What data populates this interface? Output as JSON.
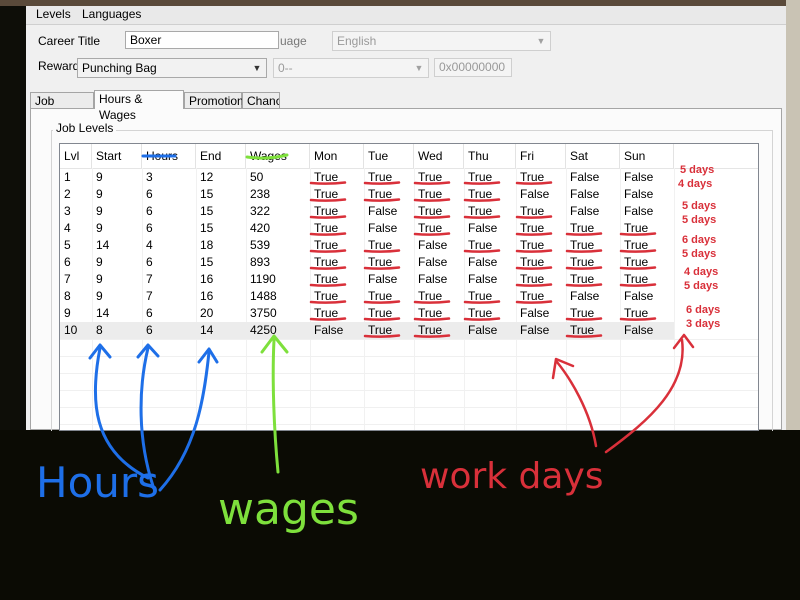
{
  "menu": {
    "items": [
      "Levels",
      "Languages"
    ]
  },
  "form": {
    "career_title_label": "Career Title",
    "career_title_value": "Boxer",
    "language_label": "uage",
    "language_value": "English",
    "reward_label": "Reward",
    "reward_value": "Punching Bag",
    "reward2_value": "0--",
    "hex_value": "0x00000000"
  },
  "tabs": [
    "Job Details",
    "Hours & Wages",
    "Promotion",
    "Chanc"
  ],
  "active_tab": "Hours & Wages",
  "group_title": "Job Levels",
  "columns": [
    "Lvl",
    "Start",
    "Hours",
    "End",
    "Wages",
    "Mon",
    "Tue",
    "Wed",
    "Thu",
    "Fri",
    "Sat",
    "Sun"
  ],
  "rows": [
    [
      "1",
      "9",
      "3",
      "12",
      "50",
      "True",
      "True",
      "True",
      "True",
      "True",
      "False",
      "False"
    ],
    [
      "2",
      "9",
      "6",
      "15",
      "238",
      "True",
      "True",
      "True",
      "True",
      "False",
      "False",
      "False"
    ],
    [
      "3",
      "9",
      "6",
      "15",
      "322",
      "True",
      "False",
      "True",
      "True",
      "True",
      "False",
      "False"
    ],
    [
      "4",
      "9",
      "6",
      "15",
      "420",
      "True",
      "False",
      "True",
      "False",
      "True",
      "True",
      "True"
    ],
    [
      "5",
      "14",
      "4",
      "18",
      "539",
      "True",
      "True",
      "False",
      "True",
      "True",
      "True",
      "True"
    ],
    [
      "6",
      "9",
      "6",
      "15",
      "893",
      "True",
      "True",
      "False",
      "False",
      "True",
      "True",
      "True"
    ],
    [
      "7",
      "9",
      "7",
      "16",
      "1190",
      "True",
      "False",
      "False",
      "False",
      "True",
      "True",
      "True"
    ],
    [
      "8",
      "9",
      "7",
      "16",
      "1488",
      "True",
      "True",
      "True",
      "True",
      "True",
      "False",
      "False"
    ],
    [
      "9",
      "14",
      "6",
      "20",
      "3750",
      "True",
      "True",
      "True",
      "True",
      "False",
      "True",
      "True"
    ],
    [
      "10",
      "8",
      "6",
      "14",
      "4250",
      "False",
      "True",
      "True",
      "False",
      "False",
      "True",
      "False"
    ]
  ],
  "selected_row": 9,
  "annotations": {
    "day_counts": [
      "5 days",
      "4 days",
      "5 days",
      "5 days",
      "6 days",
      "5 days",
      "4 days",
      "5 days",
      "6 days",
      "3 days"
    ],
    "hours_label": "Hours",
    "wages_label": "wages",
    "workdays_label": "work days",
    "colors": {
      "blue": "#1e6fe8",
      "green": "#7ee03c",
      "red": "#d9303a"
    }
  }
}
